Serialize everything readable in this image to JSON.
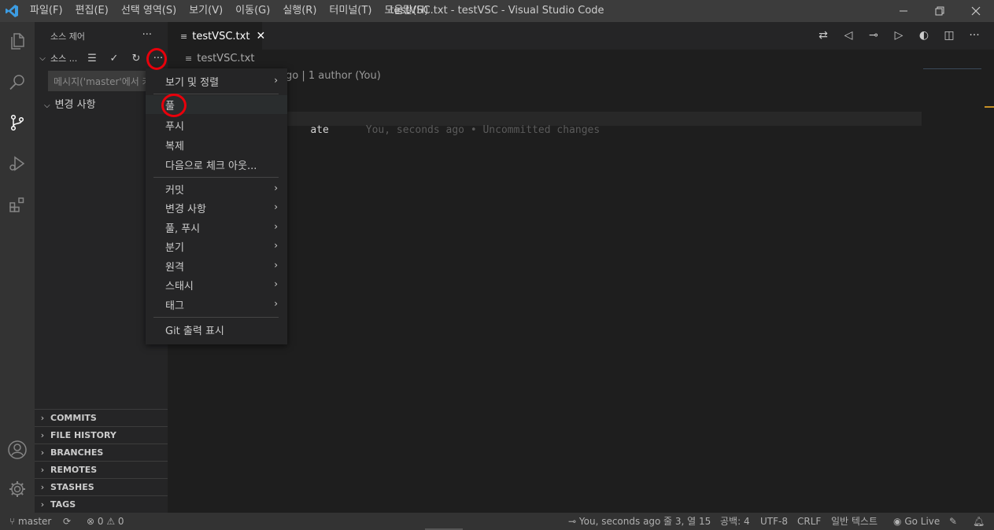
{
  "titlebar": {
    "menus": [
      "파일(F)",
      "편집(E)",
      "선택 영역(S)",
      "보기(V)",
      "이동(G)",
      "실행(R)",
      "터미널(T)",
      "도움말(H)"
    ],
    "title": "testVSC.txt - testVSC - Visual Studio Code"
  },
  "sidebar": {
    "header": "소스 제어",
    "more": "···",
    "scm_label": "소스 ...",
    "message_placeholder": "메시지('master'에서 커밋하려면 Ctrl+Enter)",
    "changes_label": "변경 사항",
    "panels": [
      "COMMITS",
      "FILE HISTORY",
      "BRANCHES",
      "REMOTES",
      "STASHES",
      "TAGS"
    ]
  },
  "editor": {
    "tab_label": "testVSC.txt",
    "breadcrumb": "testVSC.txt",
    "codelens": "go | 1 author (You)",
    "code_text": "ate",
    "blame_text": "You, seconds ago • Uncommitted changes"
  },
  "context_menu": {
    "items": [
      {
        "label": "보기 및 정렬",
        "submenu": true
      },
      {
        "label": "풀",
        "submenu": false
      },
      {
        "label": "푸시",
        "submenu": false
      },
      {
        "label": "복제",
        "submenu": false
      },
      {
        "label": "다음으로 체크 아웃...",
        "submenu": false
      },
      {
        "label": "커밋",
        "submenu": true
      },
      {
        "label": "변경 사항",
        "submenu": true
      },
      {
        "label": "풀, 푸시",
        "submenu": true
      },
      {
        "label": "분기",
        "submenu": true
      },
      {
        "label": "원격",
        "submenu": true
      },
      {
        "label": "스태시",
        "submenu": true
      },
      {
        "label": "태그",
        "submenu": true
      },
      {
        "label": "Git 출력 표시",
        "submenu": false
      }
    ]
  },
  "statusbar": {
    "branch": "master",
    "problems": "⊗ 0 ⚠ 0",
    "blame": "You, seconds ago",
    "position": "줄 3, 열 15",
    "spaces": "공백: 4",
    "encoding": "UTF-8",
    "eol": "CRLF",
    "language": "일반 텍스트",
    "golive": "Go Live"
  },
  "colors": {
    "accent_red": "#e8000b",
    "vscode_blue": "#3c9ce2"
  }
}
